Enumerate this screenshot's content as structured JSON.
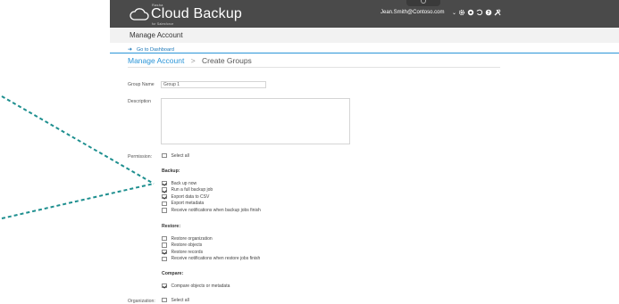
{
  "header": {
    "brand_small": "Rasha",
    "brand_name": "Cloud Backup",
    "brand_sub": "for Salesforce",
    "user_email": "Jean.Smith@Contoso.com",
    "caret": "⌄",
    "icons": [
      "gear-icon",
      "help-circle-icon",
      "refresh-icon",
      "question-icon",
      "tools-icon"
    ]
  },
  "subheader": {
    "title": "Manage Account"
  },
  "nav": {
    "dashboard_link": "Go to Dashboard"
  },
  "breadcrumb": {
    "parent": "Manage Account",
    "separator": ">",
    "current": "Create Groups"
  },
  "form": {
    "group_name_label": "Group Name",
    "group_name_value": "Group 1",
    "description_label": "Description",
    "description_value": "",
    "permission_label": "Permission:",
    "organization_label": "Organization:",
    "select_all_label": "Select all",
    "select_all_permission_checked": false,
    "select_all_org_checked": false,
    "sections": [
      {
        "title": "Backup:",
        "items": [
          {
            "label": "Back up now",
            "checked": true
          },
          {
            "label": "Run a full backup job",
            "checked": true
          },
          {
            "label": "Export data to CSV",
            "checked": true
          },
          {
            "label": "Export metadata",
            "checked": false
          },
          {
            "label": "Receive notifications when backup jobs finish",
            "checked": false
          }
        ]
      },
      {
        "title": "Restore:",
        "items": [
          {
            "label": "Restore organization",
            "checked": false
          },
          {
            "label": "Restore objects",
            "checked": false
          },
          {
            "label": "Restore records",
            "checked": true
          },
          {
            "label": "Receive notifications when restore jobs finish",
            "checked": false
          }
        ]
      },
      {
        "title": "Compare:",
        "items": [
          {
            "label": "Compare objects or metadata",
            "checked": true
          }
        ]
      }
    ]
  },
  "colors": {
    "topbar": "#4a4a4a",
    "accent": "#2a95d8",
    "annotation": "#1e8f8f"
  }
}
